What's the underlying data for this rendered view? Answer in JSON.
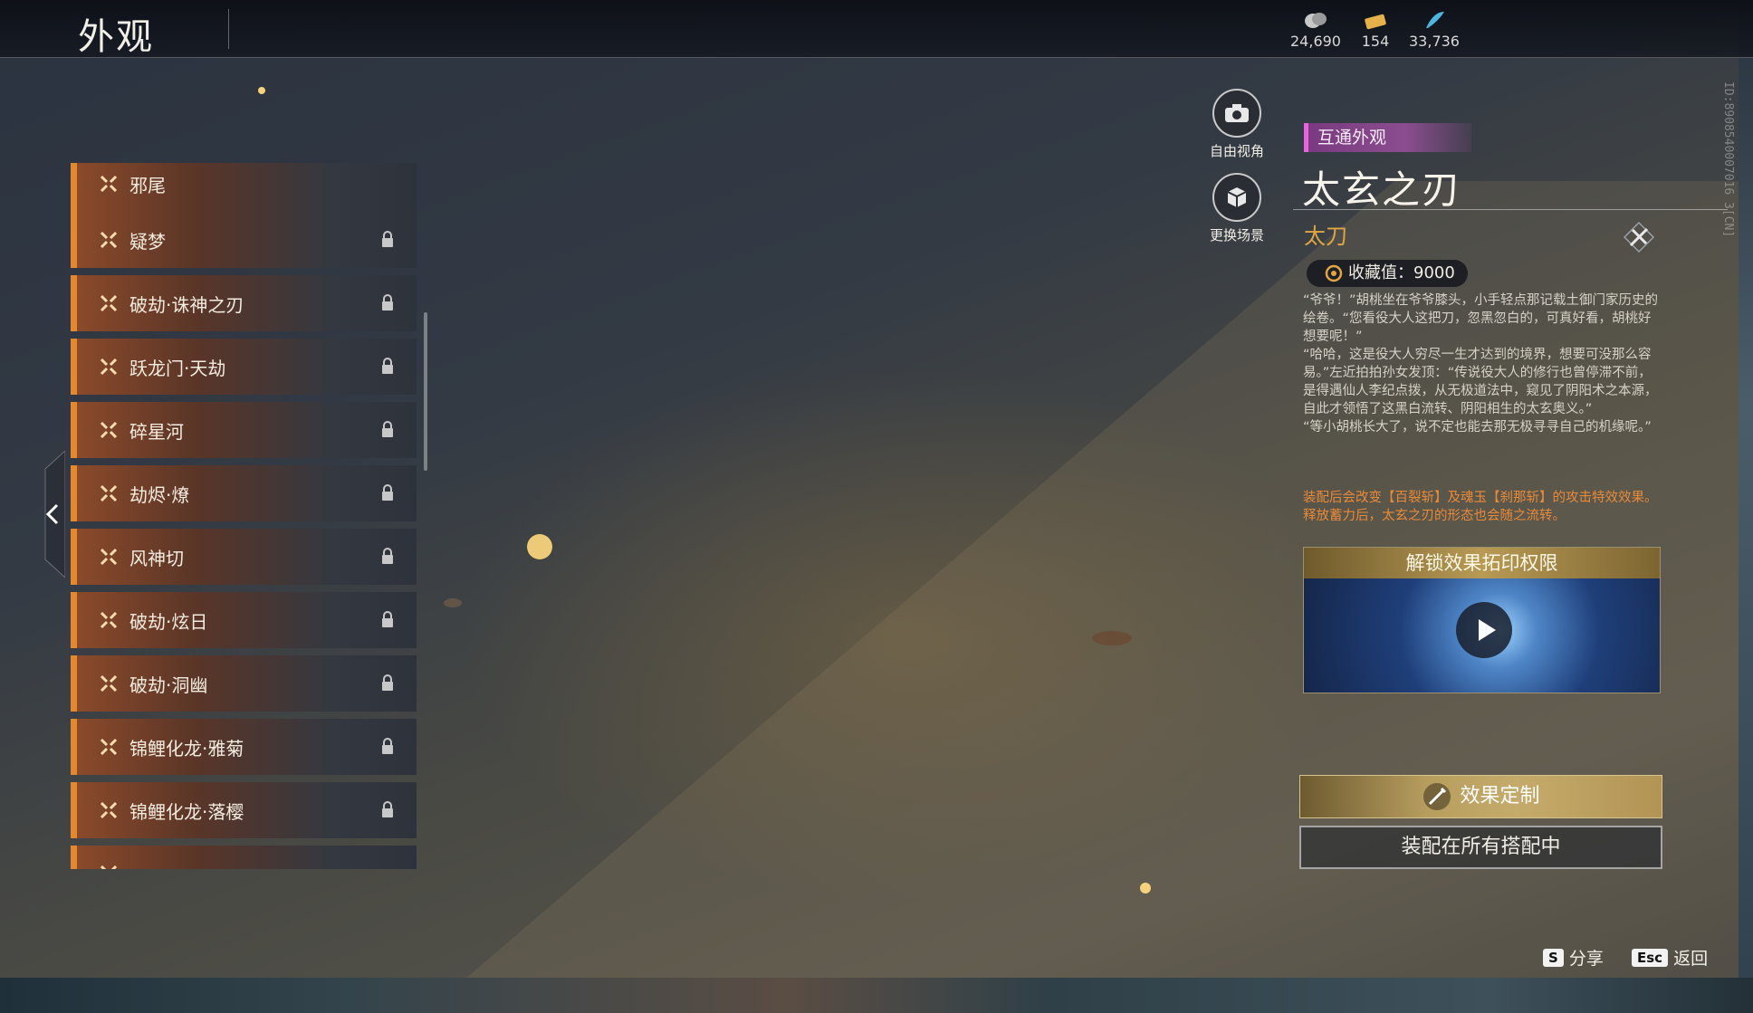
{
  "header": {
    "title": "外观",
    "currencies": [
      {
        "icon": "silver-coin-icon",
        "value": "24,690"
      },
      {
        "icon": "gold-ticket-icon",
        "value": "154"
      },
      {
        "icon": "blue-feather-icon",
        "value": "33,736"
      }
    ]
  },
  "list": {
    "items": [
      {
        "label": "邪尾",
        "locked": false
      },
      {
        "label": "疑梦",
        "locked": true
      },
      {
        "label": "破劫·诛神之刃",
        "locked": true
      },
      {
        "label": "跃龙门·天劫",
        "locked": true
      },
      {
        "label": "碎星河",
        "locked": true
      },
      {
        "label": "劫烬·燎",
        "locked": true
      },
      {
        "label": "风神切",
        "locked": true
      },
      {
        "label": "破劫·炫日",
        "locked": true
      },
      {
        "label": "破劫·洞幽",
        "locked": true
      },
      {
        "label": "锦鲤化龙·雅菊",
        "locked": true
      },
      {
        "label": "锦鲤化龙·落樱",
        "locked": true
      },
      {
        "label": "",
        "locked": true
      }
    ]
  },
  "tools": {
    "free_view": "自由视角",
    "change_scene": "更换场景"
  },
  "detail": {
    "tag": "互通外观",
    "name": "太玄之刃",
    "weapon_type": "太刀",
    "collection": "收藏值：9000",
    "description": "“爷爷！”胡桃坐在爷爷膝头，小手轻点那记载土御门家历史的绘卷。“您看役大人这把刀，忽黑忽白的，可真好看，胡桃好想要呢！”\n“哈哈，这是役大人穷尽一生才达到的境界，想要可没那么容易。”左近拍拍孙女发顶：“传说役大人的修行也曾停滞不前，是得遇仙人李纪点拨，从无极道法中，窥见了阴阳术之本源，自此才领悟了这黑白流转、阴阳相生的太玄奥义。”\n“等小胡桃长大了，说不定也能去那无极寻寻自己的机缘呢。”",
    "effect": "装配后会改变【百裂斩】及魂玉【刹那斩】的攻击特效效果。\n释放蓄力后，太玄之刃的形态也会随之流转。",
    "video_title": "解锁效果拓印权限",
    "customize_button": "效果定制",
    "equip_button": "装配在所有搭配中",
    "id_text": "ID:8908540007016 3[CN]"
  },
  "footer": {
    "share_key": "S",
    "share_label": "分享",
    "back_key": "Esc",
    "back_label": "返回"
  },
  "colors": {
    "accent_orange": "#e2892f",
    "tag_purple": "#8a4d8f",
    "type_gold": "#e1a544",
    "effect_orange": "#e98a3a"
  }
}
